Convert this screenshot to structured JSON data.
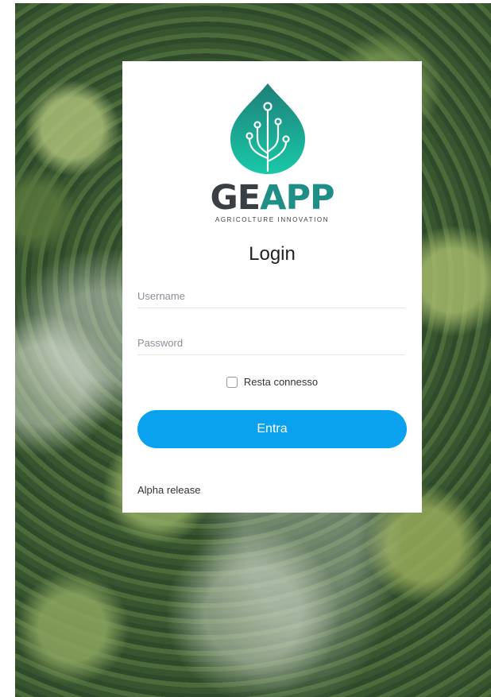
{
  "brand": {
    "name_part1": "GE",
    "name_part2": "APP",
    "tagline": "AGRICOLTURE INNOVATION",
    "colors": {
      "dark": "#3a3f43",
      "teal": "#1f8e86",
      "drop_top": "#1f7f78",
      "drop_bottom": "#18c9a8"
    }
  },
  "login": {
    "title": "Login",
    "username_placeholder": "Username",
    "password_placeholder": "Password",
    "remember_label": "Resta connesso",
    "submit_label": "Entra",
    "footer": "Alpha release"
  },
  "colors": {
    "primary": "#0aa2ee"
  }
}
